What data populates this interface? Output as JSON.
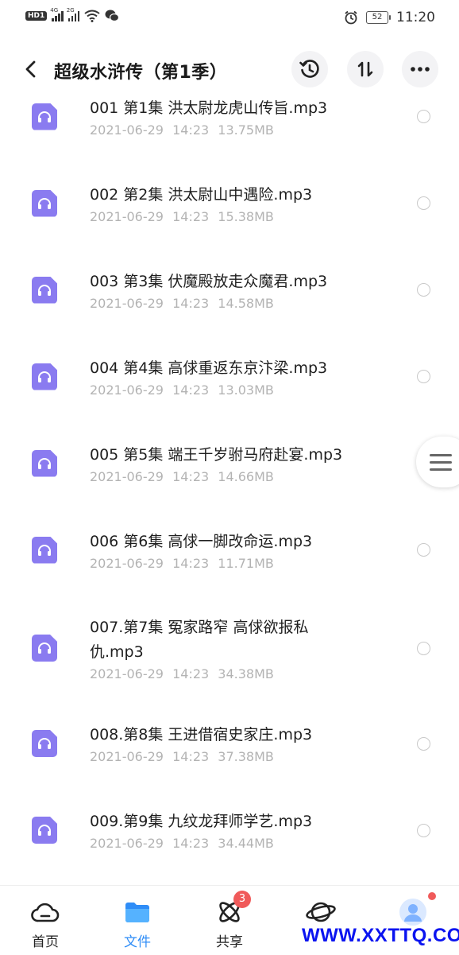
{
  "status_bar": {
    "hd_label": "HD",
    "hd_sub": "1",
    "sig1_label": "4G",
    "sig2_label": "2G",
    "battery": "52",
    "time": "11:20"
  },
  "header": {
    "title": "超级水浒传（第1季）"
  },
  "files": [
    {
      "name": "001 第1集 洪太尉龙虎山传旨.mp3",
      "date": "2021-06-29",
      "time": "14:23",
      "size": "13.75MB"
    },
    {
      "name": "002 第2集 洪太尉山中遇险.mp3",
      "date": "2021-06-29",
      "time": "14:23",
      "size": "15.38MB"
    },
    {
      "name": "003 第3集 伏魔殿放走众魔君.mp3",
      "date": "2021-06-29",
      "time": "14:23",
      "size": "14.58MB"
    },
    {
      "name": "004 第4集 高俅重返东京汴梁.mp3",
      "date": "2021-06-29",
      "time": "14:23",
      "size": "13.03MB"
    },
    {
      "name": "005 第5集 端王千岁驸马府赴宴.mp3",
      "date": "2021-06-29",
      "time": "14:23",
      "size": "14.66MB"
    },
    {
      "name": "006 第6集 高俅一脚改命运.mp3",
      "date": "2021-06-29",
      "time": "14:23",
      "size": "11.71MB"
    },
    {
      "name": "007.第7集 冤家路窄 高俅欲报私仇.mp3",
      "date": "2021-06-29",
      "time": "14:23",
      "size": "34.38MB"
    },
    {
      "name": "008.第8集 王进借宿史家庄.mp3",
      "date": "2021-06-29",
      "time": "14:23",
      "size": "37.38MB"
    },
    {
      "name": "009.第9集 九纹龙拜师学艺.mp3",
      "date": "2021-06-29",
      "time": "14:23",
      "size": "34.44MB"
    }
  ],
  "bottom_nav": {
    "tabs": [
      {
        "label": "首页",
        "icon": "cloud-icon"
      },
      {
        "label": "文件",
        "icon": "folder-icon",
        "active": true
      },
      {
        "label": "共享",
        "icon": "share-atom-icon",
        "badge": "3"
      },
      {
        "label": "",
        "icon": "planet-icon"
      },
      {
        "label": "",
        "icon": "avatar-icon"
      }
    ]
  },
  "watermark": "WWW.XXTTQ.COM",
  "colors": {
    "file_icon": "#8a7bf0",
    "active_tab": "#2f8df7",
    "badge": "#f05a5a",
    "meta_text": "#b3b3b3"
  }
}
